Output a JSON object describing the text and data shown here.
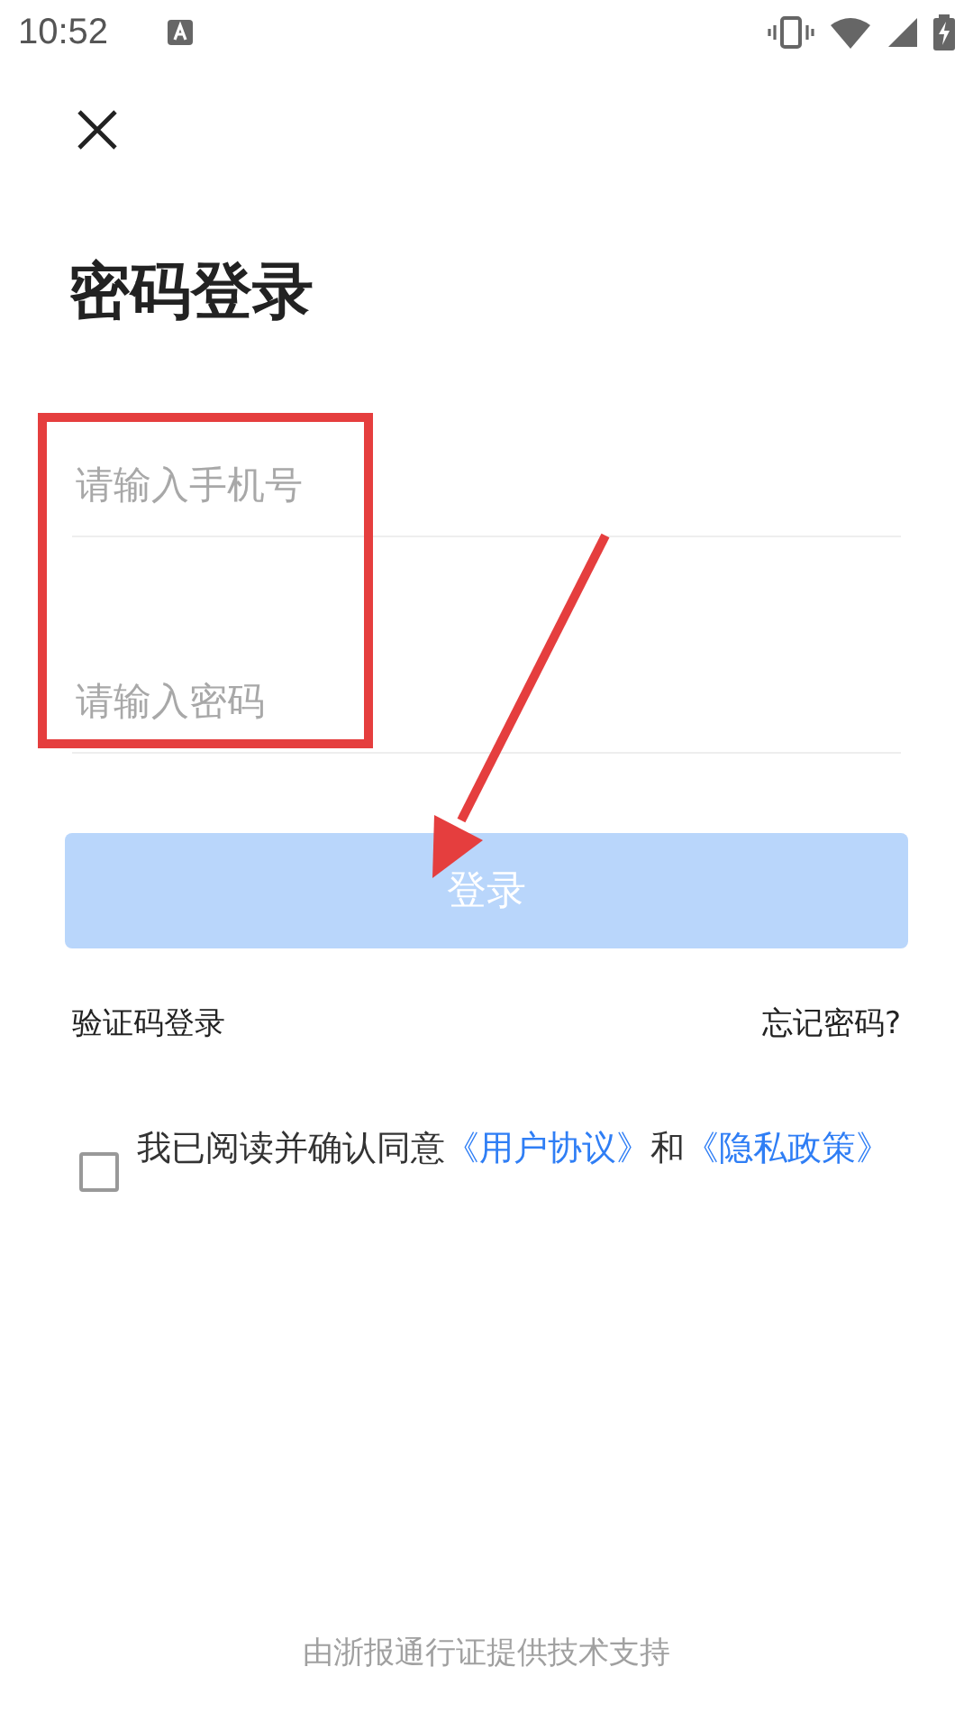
{
  "status_bar": {
    "time": "10:52"
  },
  "title": "密码登录",
  "fields": [
    {
      "placeholder": "请输入手机号"
    },
    {
      "placeholder": "请输入密码"
    }
  ],
  "login_button": {
    "label": "登录",
    "disabled": true
  },
  "links": [
    {
      "label": "验证码登录"
    },
    {
      "label": "忘记密码?"
    }
  ],
  "agreement": {
    "checked": false,
    "text": "我已阅读并确认同意",
    "link_1": "《用户协议》",
    "joiner": "和",
    "link_2": "《隐私政策》"
  },
  "footer": "由浙报通行证提供技术支持",
  "highlight_box": {
    "color": "#e53e3e"
  },
  "arrow": {
    "color": "#e53e3e"
  }
}
